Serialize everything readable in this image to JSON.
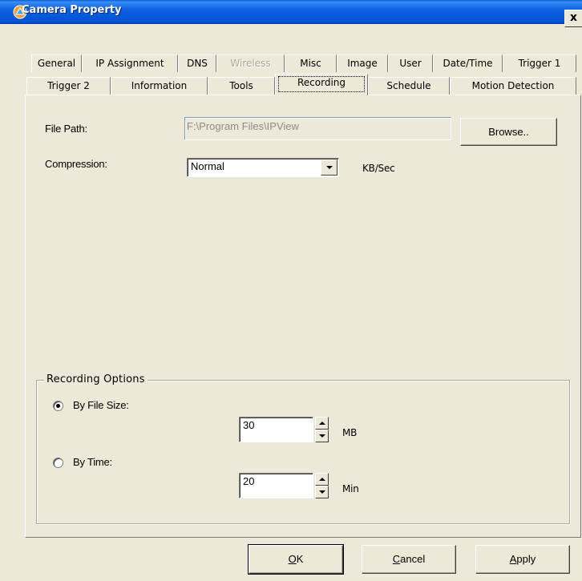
{
  "window": {
    "title": "Camera Property",
    "close_glyph": "x"
  },
  "tabs_row1": [
    {
      "label": "General",
      "disabled": false
    },
    {
      "label": "IP Assignment",
      "disabled": false
    },
    {
      "label": "DNS",
      "disabled": false
    },
    {
      "label": "Wireless",
      "disabled": true
    },
    {
      "label": "Misc",
      "disabled": false
    },
    {
      "label": "Image",
      "disabled": false
    },
    {
      "label": "User",
      "disabled": false
    },
    {
      "label": "Date/Time",
      "disabled": false
    },
    {
      "label": "Trigger 1",
      "disabled": false
    }
  ],
  "tabs_row2": [
    {
      "label": "Trigger 2",
      "active": false
    },
    {
      "label": "Information",
      "active": false
    },
    {
      "label": "Tools",
      "active": false
    },
    {
      "label": "Recording",
      "active": true
    },
    {
      "label": "Schedule",
      "active": false
    },
    {
      "label": "Motion Detection",
      "active": false
    }
  ],
  "recording": {
    "file_path_label": "File Path:",
    "file_path_value": "F:\\Program Files\\IPView",
    "browse_label": "Browse..",
    "compression_label": "Compression:",
    "compression_value": "Normal",
    "compression_unit": "KB/Sec"
  },
  "options": {
    "group_title": "Recording Options",
    "by_file_size_label": "By File Size:",
    "by_file_size_selected": true,
    "file_size_value": "30",
    "file_size_unit": "MB",
    "by_time_label": "By Time:",
    "by_time_selected": false,
    "time_value": "20",
    "time_unit": "Min"
  },
  "buttons": {
    "ok_mnemonic": "O",
    "ok_rest": "K",
    "cancel_mnemonic": "C",
    "cancel_rest": "ancel",
    "apply_mnemonic": "A",
    "apply_rest": "pply"
  },
  "colors": {
    "titlebar": "#0454d6",
    "dialog_bg": "#ece9d8",
    "disabled_text": "#aca899"
  }
}
